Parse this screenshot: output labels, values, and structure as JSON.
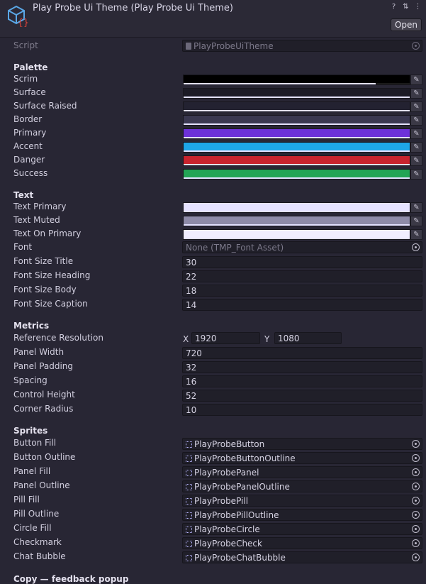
{
  "header": {
    "title": "Play Probe Ui Theme (Play Probe Ui Theme)",
    "help_icon": "?",
    "settings_icon": "⇅",
    "more_icon": "⋮",
    "open_label": "Open"
  },
  "script": {
    "label": "Script",
    "value": "PlayProbeUiTheme"
  },
  "palette": {
    "heading": "Palette",
    "items": [
      {
        "label": "Scrim",
        "color": "#000000",
        "alpha": 0.85
      },
      {
        "label": "Surface",
        "color": "#1c1b26",
        "alpha": 1.0
      },
      {
        "label": "Surface Raised",
        "color": "#232231",
        "alpha": 1.0
      },
      {
        "label": "Border",
        "color": "#3a3850",
        "alpha": 1.0
      },
      {
        "label": "Primary",
        "color": "#6d32d9",
        "alpha": 1.0
      },
      {
        "label": "Accent",
        "color": "#1ea7e8",
        "alpha": 1.0
      },
      {
        "label": "Danger",
        "color": "#c8242e",
        "alpha": 1.0
      },
      {
        "label": "Success",
        "color": "#23a455",
        "alpha": 1.0
      }
    ]
  },
  "text": {
    "heading": "Text",
    "colors": [
      {
        "label": "Text Primary",
        "color": "#e5e2ff",
        "alpha": 1.0
      },
      {
        "label": "Text Muted",
        "color": "#8e8ba8",
        "alpha": 1.0
      },
      {
        "label": "Text On Primary",
        "color": "#f1eeff",
        "alpha": 1.0
      }
    ],
    "font": {
      "label": "Font",
      "value": "None (TMP_Font Asset)"
    },
    "sizes": [
      {
        "label": "Font Size Title",
        "value": "30"
      },
      {
        "label": "Font Size Heading",
        "value": "22"
      },
      {
        "label": "Font Size Body",
        "value": "18"
      },
      {
        "label": "Font Size Caption",
        "value": "14"
      }
    ]
  },
  "metrics": {
    "heading": "Metrics",
    "resolution": {
      "label": "Reference Resolution",
      "x_label": "X",
      "x": "1920",
      "y_label": "Y",
      "y": "1080"
    },
    "items": [
      {
        "label": "Panel Width",
        "value": "720"
      },
      {
        "label": "Panel Padding",
        "value": "32"
      },
      {
        "label": "Spacing",
        "value": "16"
      },
      {
        "label": "Control Height",
        "value": "52"
      },
      {
        "label": "Corner Radius",
        "value": "10"
      }
    ]
  },
  "sprites": {
    "heading": "Sprites",
    "items": [
      {
        "label": "Button Fill",
        "value": "PlayProbeButton"
      },
      {
        "label": "Button Outline",
        "value": "PlayProbeButtonOutline"
      },
      {
        "label": "Panel Fill",
        "value": "PlayProbePanel"
      },
      {
        "label": "Panel Outline",
        "value": "PlayProbePanelOutline"
      },
      {
        "label": "Pill Fill",
        "value": "PlayProbePill"
      },
      {
        "label": "Pill Outline",
        "value": "PlayProbePillOutline"
      },
      {
        "label": "Circle Fill",
        "value": "PlayProbeCircle"
      },
      {
        "label": "Checkmark",
        "value": "PlayProbeCheck"
      },
      {
        "label": "Chat Bubble",
        "value": "PlayProbeChatBubble"
      }
    ]
  },
  "copy": {
    "heading": "Copy — feedback popup"
  }
}
